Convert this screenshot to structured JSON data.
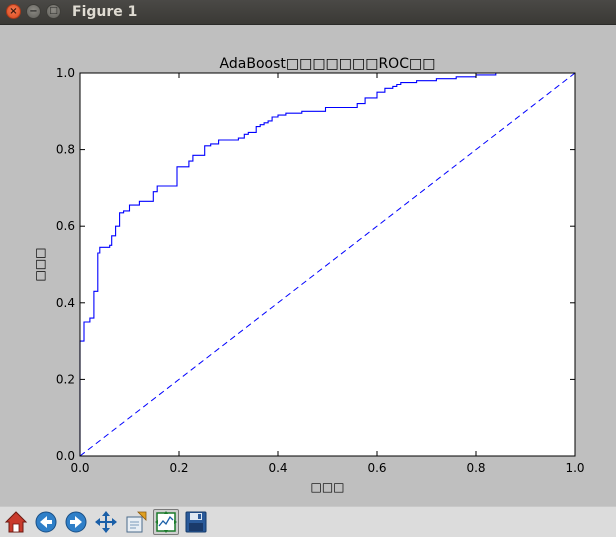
{
  "window": {
    "title": "Figure 1",
    "close_symbol": "×",
    "minimize_symbol": "−",
    "maximize_symbol": "□"
  },
  "chart_data": {
    "type": "line",
    "title": "AdaBoost□□□□□□□ROC□□",
    "xlabel": "□□□",
    "ylabel": "□□□",
    "xlim": [
      0.0,
      1.0
    ],
    "ylim": [
      0.0,
      1.0
    ],
    "x_ticks": [
      "0.0",
      "0.2",
      "0.4",
      "0.6",
      "0.8",
      "1.0"
    ],
    "y_ticks": [
      "0.0",
      "0.2",
      "0.4",
      "0.6",
      "0.8",
      "1.0"
    ],
    "grid": false,
    "legend": "none",
    "colors": {
      "roc": "#0000ff",
      "diagonal": "#0000ff",
      "axes_bg": "#ffffff",
      "figure_bg": "#bfbfbf"
    },
    "series": [
      {
        "style": "solid-step",
        "x": [
          0.0,
          0.0,
          0.008,
          0.008,
          0.02,
          0.02,
          0.028,
          0.028,
          0.036,
          0.036,
          0.04,
          0.04,
          0.06,
          0.06,
          0.064,
          0.064,
          0.072,
          0.072,
          0.08,
          0.08,
          0.088,
          0.088,
          0.1,
          0.1,
          0.12,
          0.12,
          0.148,
          0.148,
          0.156,
          0.156,
          0.196,
          0.196,
          0.22,
          0.22,
          0.228,
          0.228,
          0.252,
          0.252,
          0.264,
          0.264,
          0.28,
          0.28,
          0.32,
          0.32,
          0.332,
          0.332,
          0.34,
          0.34,
          0.356,
          0.356,
          0.364,
          0.364,
          0.372,
          0.372,
          0.38,
          0.38,
          0.388,
          0.388,
          0.4,
          0.4,
          0.416,
          0.416,
          0.448,
          0.448,
          0.496,
          0.496,
          0.56,
          0.56,
          0.576,
          0.576,
          0.6,
          0.6,
          0.616,
          0.616,
          0.632,
          0.632,
          0.64,
          0.64,
          0.648,
          0.648,
          0.68,
          0.68,
          0.72,
          0.72,
          0.76,
          0.76,
          0.8,
          0.8,
          0.84,
          0.84,
          0.88,
          0.88
        ],
        "y": [
          0.0,
          0.3,
          0.3,
          0.35,
          0.35,
          0.36,
          0.36,
          0.43,
          0.43,
          0.53,
          0.53,
          0.545,
          0.545,
          0.55,
          0.55,
          0.575,
          0.575,
          0.6,
          0.6,
          0.635,
          0.635,
          0.64,
          0.64,
          0.655,
          0.655,
          0.665,
          0.665,
          0.69,
          0.69,
          0.705,
          0.705,
          0.755,
          0.755,
          0.77,
          0.77,
          0.785,
          0.785,
          0.81,
          0.81,
          0.815,
          0.815,
          0.825,
          0.825,
          0.83,
          0.83,
          0.84,
          0.84,
          0.845,
          0.845,
          0.86,
          0.86,
          0.865,
          0.865,
          0.87,
          0.87,
          0.875,
          0.875,
          0.885,
          0.885,
          0.89,
          0.89,
          0.895,
          0.895,
          0.9,
          0.9,
          0.91,
          0.91,
          0.92,
          0.92,
          0.935,
          0.935,
          0.95,
          0.95,
          0.96,
          0.96,
          0.965,
          0.965,
          0.97,
          0.97,
          0.975,
          0.975,
          0.98,
          0.98,
          0.985,
          0.985,
          0.99,
          0.99,
          0.995,
          0.995,
          1.0,
          1.0,
          1.0
        ]
      },
      {
        "style": "dashed",
        "x": [
          0.0,
          1.0
        ],
        "y": [
          0.0,
          1.0
        ]
      }
    ]
  },
  "toolbar": {
    "tools": [
      {
        "name": "home-icon",
        "checked": false
      },
      {
        "name": "back-icon",
        "checked": false
      },
      {
        "name": "forward-icon",
        "checked": false
      },
      {
        "name": "pan-icon",
        "checked": false
      },
      {
        "name": "zoom-icon",
        "checked": false
      },
      {
        "name": "configure-subplots-icon",
        "checked": true
      },
      {
        "name": "save-icon",
        "checked": false
      }
    ]
  }
}
